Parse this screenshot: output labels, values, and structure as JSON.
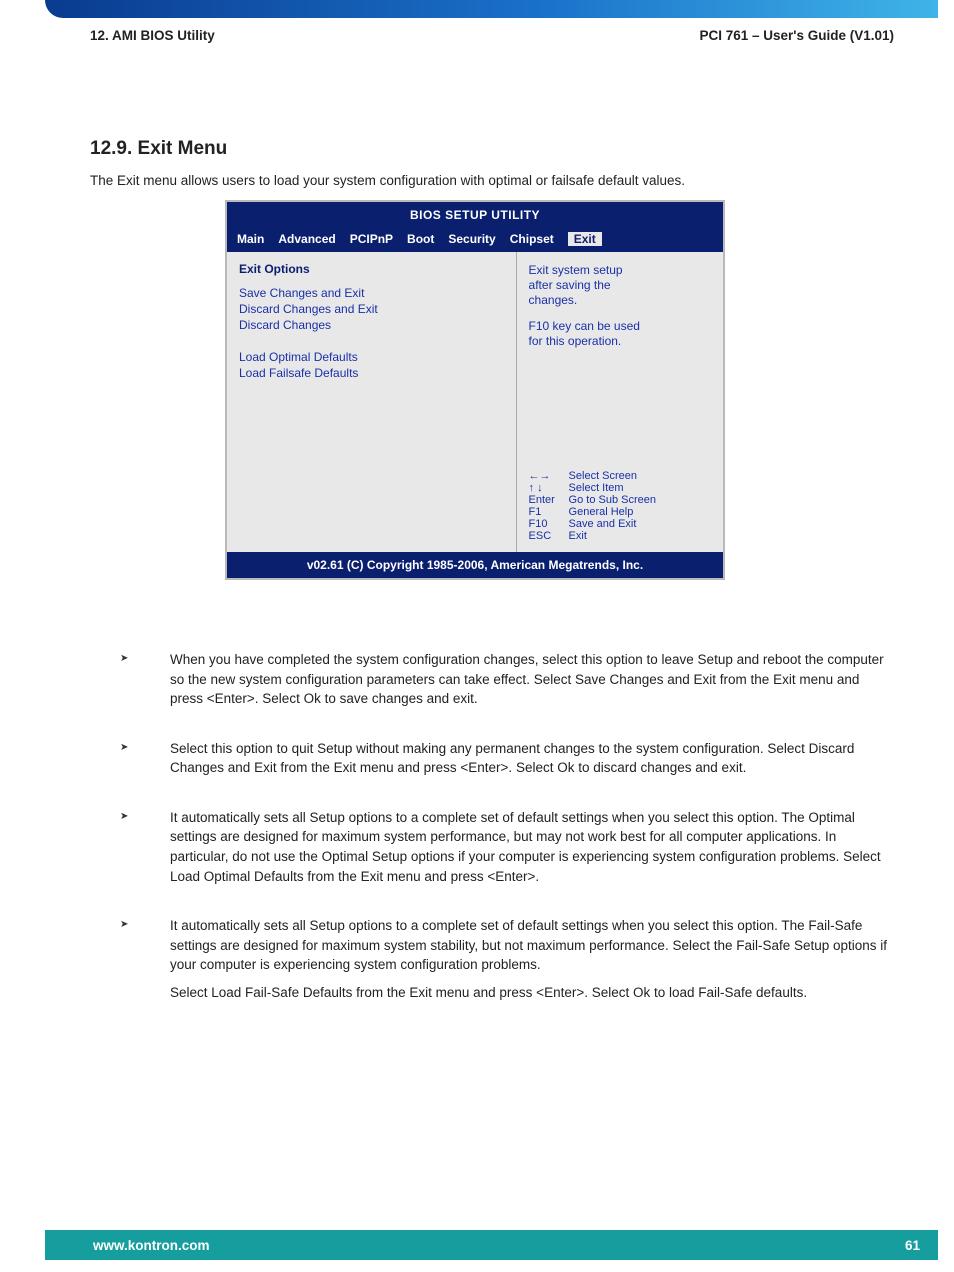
{
  "header": {
    "left": "12. AMI BIOS Utility",
    "right": "PCI 761 – User's Guide (V1.01)"
  },
  "section": {
    "title": "12.9. Exit Menu",
    "intro": "The Exit menu allows users to load your system configuration with optimal or failsafe default values."
  },
  "bios": {
    "title": "BIOS SETUP UTILITY",
    "tabs": {
      "main": "Main",
      "advanced": "Advanced",
      "pcipnp": "PCIPnP",
      "boot": "Boot",
      "security": "Security",
      "chipset": "Chipset",
      "exit": "Exit"
    },
    "left": {
      "heading": "Exit Options",
      "opt1": "Save Changes and Exit",
      "opt2": "Discard Changes and Exit",
      "opt3": "Discard Changes",
      "opt4": "Load Optimal Defaults",
      "opt5": "Load Failsafe Defaults"
    },
    "right": {
      "help1": "Exit system setup",
      "help2": "after saving the",
      "help3": "changes.",
      "help4": "F10 key can be used",
      "help5": "for this operation.",
      "k_arrow_lr": "←→",
      "k_arrow_lr_label": "Select Screen",
      "k_arrow_ud": "↑ ↓",
      "k_arrow_ud_label": "Select Item",
      "k_enter": "Enter",
      "k_enter_label": "Go to Sub Screen",
      "k_f1": "F1",
      "k_f1_label": "General Help",
      "k_f10": "F10",
      "k_f10_label": "Save and Exit",
      "k_esc": "ESC",
      "k_esc_label": "Exit"
    },
    "footer": "v02.61 (C) Copyright 1985-2006, American Megatrends, Inc."
  },
  "bullets": {
    "b1": "When you have completed the system configuration changes, select this option to leave Setup and reboot the computer so the new system configuration parameters can take effect. Select Save Changes and Exit from the Exit menu and press <Enter>. Select Ok to save changes and exit.",
    "b2": "Select this option to quit Setup without making any permanent changes to the system configuration. Select Discard Changes and Exit from the Exit menu and press <Enter>. Select Ok to discard changes and exit.",
    "b3": "It automatically sets all Setup options to a complete set of default settings when you select this option. The Optimal settings are designed for maximum system performance, but may not work best for all computer applications. In particular, do not use the Optimal Setup options if your computer is experiencing system configuration problems. Select Load Optimal Defaults from the Exit menu and press <Enter>.",
    "b4a": "It automatically sets all Setup options to a complete set of default settings when you select this option. The Fail-Safe settings are designed for maximum system stability, but not maximum performance. Select the Fail-Safe Setup options if your computer is experiencing system configuration problems.",
    "b4b": "Select Load Fail-Safe Defaults from the Exit menu and press <Enter>. Select Ok to load Fail-Safe defaults."
  },
  "footer": {
    "url": "www.kontron.com",
    "page": "61"
  }
}
